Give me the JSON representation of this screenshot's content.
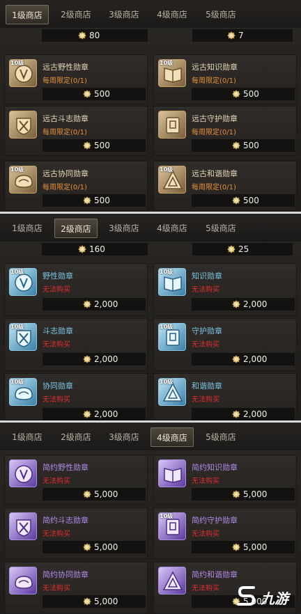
{
  "colors": {
    "orange": "#e7923a",
    "cyan": "#7cc6e4",
    "purple": "#b28be8",
    "red": "#e02e2e",
    "gold_name": "#e8d8b6"
  },
  "panel1": {
    "tabs": [
      "1级商店",
      "2级商店",
      "3级商店",
      "4级商店",
      "5级商店"
    ],
    "active_tab": 0,
    "top_values": [
      "80",
      "7"
    ],
    "items": [
      {
        "tag": "10级",
        "name": "远古野性勋章",
        "limit": "每周限定(0/1)",
        "price": "500",
        "icon": "wild-medal-icon"
      },
      {
        "tag": "10级",
        "name": "远古知识勋章",
        "limit": "每周限定(0/1)",
        "price": "500",
        "icon": "knowledge-medal-icon"
      },
      {
        "tag": "",
        "name": "远古斗志勋章",
        "limit": "每周限定(0/1)",
        "price": "500",
        "icon": "fighting-medal-icon"
      },
      {
        "tag": "",
        "name": "远古守护勋章",
        "limit": "每周限定(0/1)",
        "price": "500",
        "icon": "guard-medal-icon"
      },
      {
        "tag": "10级",
        "name": "远古协同勋章",
        "limit": "每周限定(0/1)",
        "price": "500",
        "icon": "cooperation-medal-icon"
      },
      {
        "tag": "10级",
        "name": "远古和谐勋章",
        "limit": "每周限定(0/1)",
        "price": "500",
        "icon": "harmony-medal-icon"
      }
    ]
  },
  "panel2": {
    "tabs": [
      "1级商店",
      "2级商店",
      "3级商店",
      "4级商店",
      "5级商店"
    ],
    "active_tab": 1,
    "top_values": [
      "160",
      "25"
    ],
    "items": [
      {
        "tag": "10级",
        "name": "野性勋章",
        "limit": "无法购买",
        "price": "2,000",
        "icon": "wild-medal-icon"
      },
      {
        "tag": "10级",
        "name": "知识勋章",
        "limit": "无法购买",
        "price": "2,000",
        "icon": "knowledge-medal-icon"
      },
      {
        "tag": "10级",
        "name": "斗志勋章",
        "limit": "无法购买",
        "price": "2,000",
        "icon": "fighting-medal-icon"
      },
      {
        "tag": "10级",
        "name": "守护勋章",
        "limit": "无法购买",
        "price": "2,000",
        "icon": "guard-medal-icon"
      },
      {
        "tag": "10级",
        "name": "协同勋章",
        "limit": "无法购买",
        "price": "2,000",
        "icon": "cooperation-medal-icon"
      },
      {
        "tag": "10级",
        "name": "和谐勋章",
        "limit": "无法购买",
        "price": "2,000",
        "icon": "harmony-medal-icon"
      }
    ]
  },
  "panel3": {
    "tabs": [
      "1级商店",
      "2级商店",
      "3级商店",
      "4级商店",
      "5级商店"
    ],
    "active_tab": 3,
    "items": [
      {
        "tag": "",
        "name": "简约野性勋章",
        "limit": "无法购买",
        "price": "5,000",
        "icon": "wild-medal-icon"
      },
      {
        "tag": "",
        "name": "简约知识勋章",
        "limit": "无法购买",
        "price": "5,000",
        "icon": "knowledge-medal-icon"
      },
      {
        "tag": "",
        "name": "简约斗志勋章",
        "limit": "无法购买",
        "price": "5,000",
        "icon": "fighting-medal-icon"
      },
      {
        "tag": "10级",
        "name": "简约守护勋章",
        "limit": "无法购买",
        "price": "5,000",
        "icon": "guard-medal-icon"
      },
      {
        "tag": "",
        "name": "简约协同勋章",
        "limit": "无法购买",
        "price": "5,000",
        "icon": "cooperation-medal-icon"
      },
      {
        "tag": "",
        "name": "简约和谐勋章",
        "limit": "无法购买",
        "price": "5,000",
        "icon": "harmony-medal-icon"
      }
    ]
  },
  "watermark": {
    "text": "九游"
  }
}
